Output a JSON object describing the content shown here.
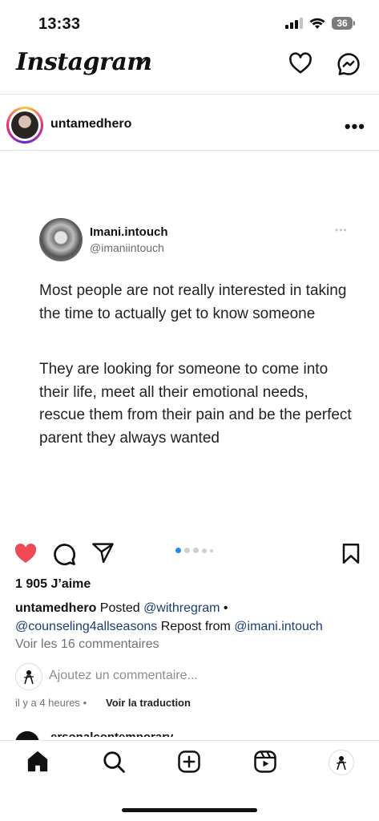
{
  "status_bar": {
    "time": "13:33",
    "battery": "36"
  },
  "header": {
    "title": "Instagram"
  },
  "post": {
    "username": "untamedhero",
    "more": "•••",
    "tweet": {
      "name": "Imani.intouch",
      "handle": "@imaniintouch",
      "dots": "•••",
      "paragraph1": "Most people are not really interested in taking the time to actually get to know someone",
      "paragraph2": "They are looking for someone to come into their life, meet all their emotional needs, rescue them from their pain and be the perfect parent they always wanted"
    },
    "carousel": {
      "total": 5,
      "active_index": 0
    },
    "likes": "1 905 J’aime",
    "caption": {
      "username": "untamedhero",
      "text1": "Posted",
      "mention1": "@withregram",
      "sep": "•",
      "mention2": "@counseling4allseasons",
      "text2": "Repost from",
      "mention3": "@imani.intouch"
    },
    "view_comments": "Voir les 16 commentaires",
    "add_comment_placeholder": "Ajoutez un commentaire...",
    "time_ago": "il y a 4 heures",
    "separator": "•",
    "translate": "Voir la traduction"
  },
  "next_post": {
    "username": "ersonalcontemporary"
  },
  "colors": {
    "accent_like": "#ed4956",
    "mention": "#1a3d73",
    "carousel_active": "#1a8cff"
  },
  "icons": [
    "signal-icon",
    "wifi-icon",
    "battery-icon",
    "chevron-down-icon",
    "heart-icon",
    "messenger-icon",
    "comment-icon",
    "share-icon",
    "bookmark-icon",
    "home-icon",
    "search-icon",
    "create-icon",
    "reels-icon",
    "profile-icon"
  ]
}
